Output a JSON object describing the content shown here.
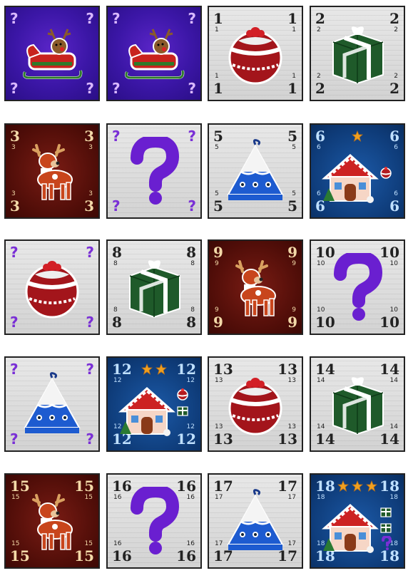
{
  "cards": [
    {
      "id": "c1",
      "bg": "purple",
      "type": "mystery",
      "art": "sleigh",
      "big": "?",
      "small": ""
    },
    {
      "id": "c2",
      "bg": "purple",
      "type": "mystery",
      "art": "sleigh",
      "big": "?",
      "small": ""
    },
    {
      "id": "c3",
      "bg": "white",
      "type": "number",
      "art": "ornament",
      "big": "1",
      "small": "1"
    },
    {
      "id": "c4",
      "bg": "white",
      "type": "number",
      "art": "gift",
      "big": "2",
      "small": "2"
    },
    {
      "id": "c5",
      "bg": "maroon",
      "type": "number",
      "art": "reindeer",
      "big": "3",
      "small": "3"
    },
    {
      "id": "c6",
      "bg": "white",
      "type": "mystery",
      "art": "question",
      "big": "?",
      "small": ""
    },
    {
      "id": "c7",
      "bg": "white",
      "type": "number",
      "art": "tree-ornament",
      "big": "5",
      "small": "5"
    },
    {
      "id": "c8",
      "bg": "blue",
      "type": "number",
      "art": "house",
      "big": "6",
      "small": "6",
      "stars": 1
    },
    {
      "id": "c9",
      "bg": "white",
      "type": "mystery",
      "art": "ornament",
      "big": "?",
      "small": ""
    },
    {
      "id": "c10",
      "bg": "white",
      "type": "number",
      "art": "gift",
      "big": "8",
      "small": "8"
    },
    {
      "id": "c11",
      "bg": "maroon",
      "type": "number",
      "art": "reindeer",
      "big": "9",
      "small": "9"
    },
    {
      "id": "c12",
      "bg": "white",
      "type": "number",
      "art": "question",
      "big": "10",
      "small": "10"
    },
    {
      "id": "c13",
      "bg": "white",
      "type": "mystery",
      "art": "tree-ornament",
      "big": "?",
      "small": ""
    },
    {
      "id": "c14",
      "bg": "blue",
      "type": "number",
      "art": "house",
      "big": "12",
      "small": "12",
      "stars": 2
    },
    {
      "id": "c15",
      "bg": "white",
      "type": "number",
      "art": "ornament",
      "big": "13",
      "small": "13"
    },
    {
      "id": "c16",
      "bg": "white",
      "type": "number",
      "art": "gift",
      "big": "14",
      "small": "14"
    },
    {
      "id": "c17",
      "bg": "maroon",
      "type": "number",
      "art": "reindeer",
      "big": "15",
      "small": "15"
    },
    {
      "id": "c18",
      "bg": "white",
      "type": "number",
      "art": "question",
      "big": "16",
      "small": "16"
    },
    {
      "id": "c19",
      "bg": "white",
      "type": "number",
      "art": "tree-ornament",
      "big": "17",
      "small": "17"
    },
    {
      "id": "c20",
      "bg": "blue",
      "type": "number",
      "art": "house",
      "big": "18",
      "small": "18",
      "stars": 3
    }
  ],
  "colors": {
    "purple": "#3b16a6",
    "maroon": "#4f0d08",
    "blue": "#0e3b78",
    "white": "#eeeeee",
    "star": "#f0a020",
    "question": "#7a2fd6"
  }
}
